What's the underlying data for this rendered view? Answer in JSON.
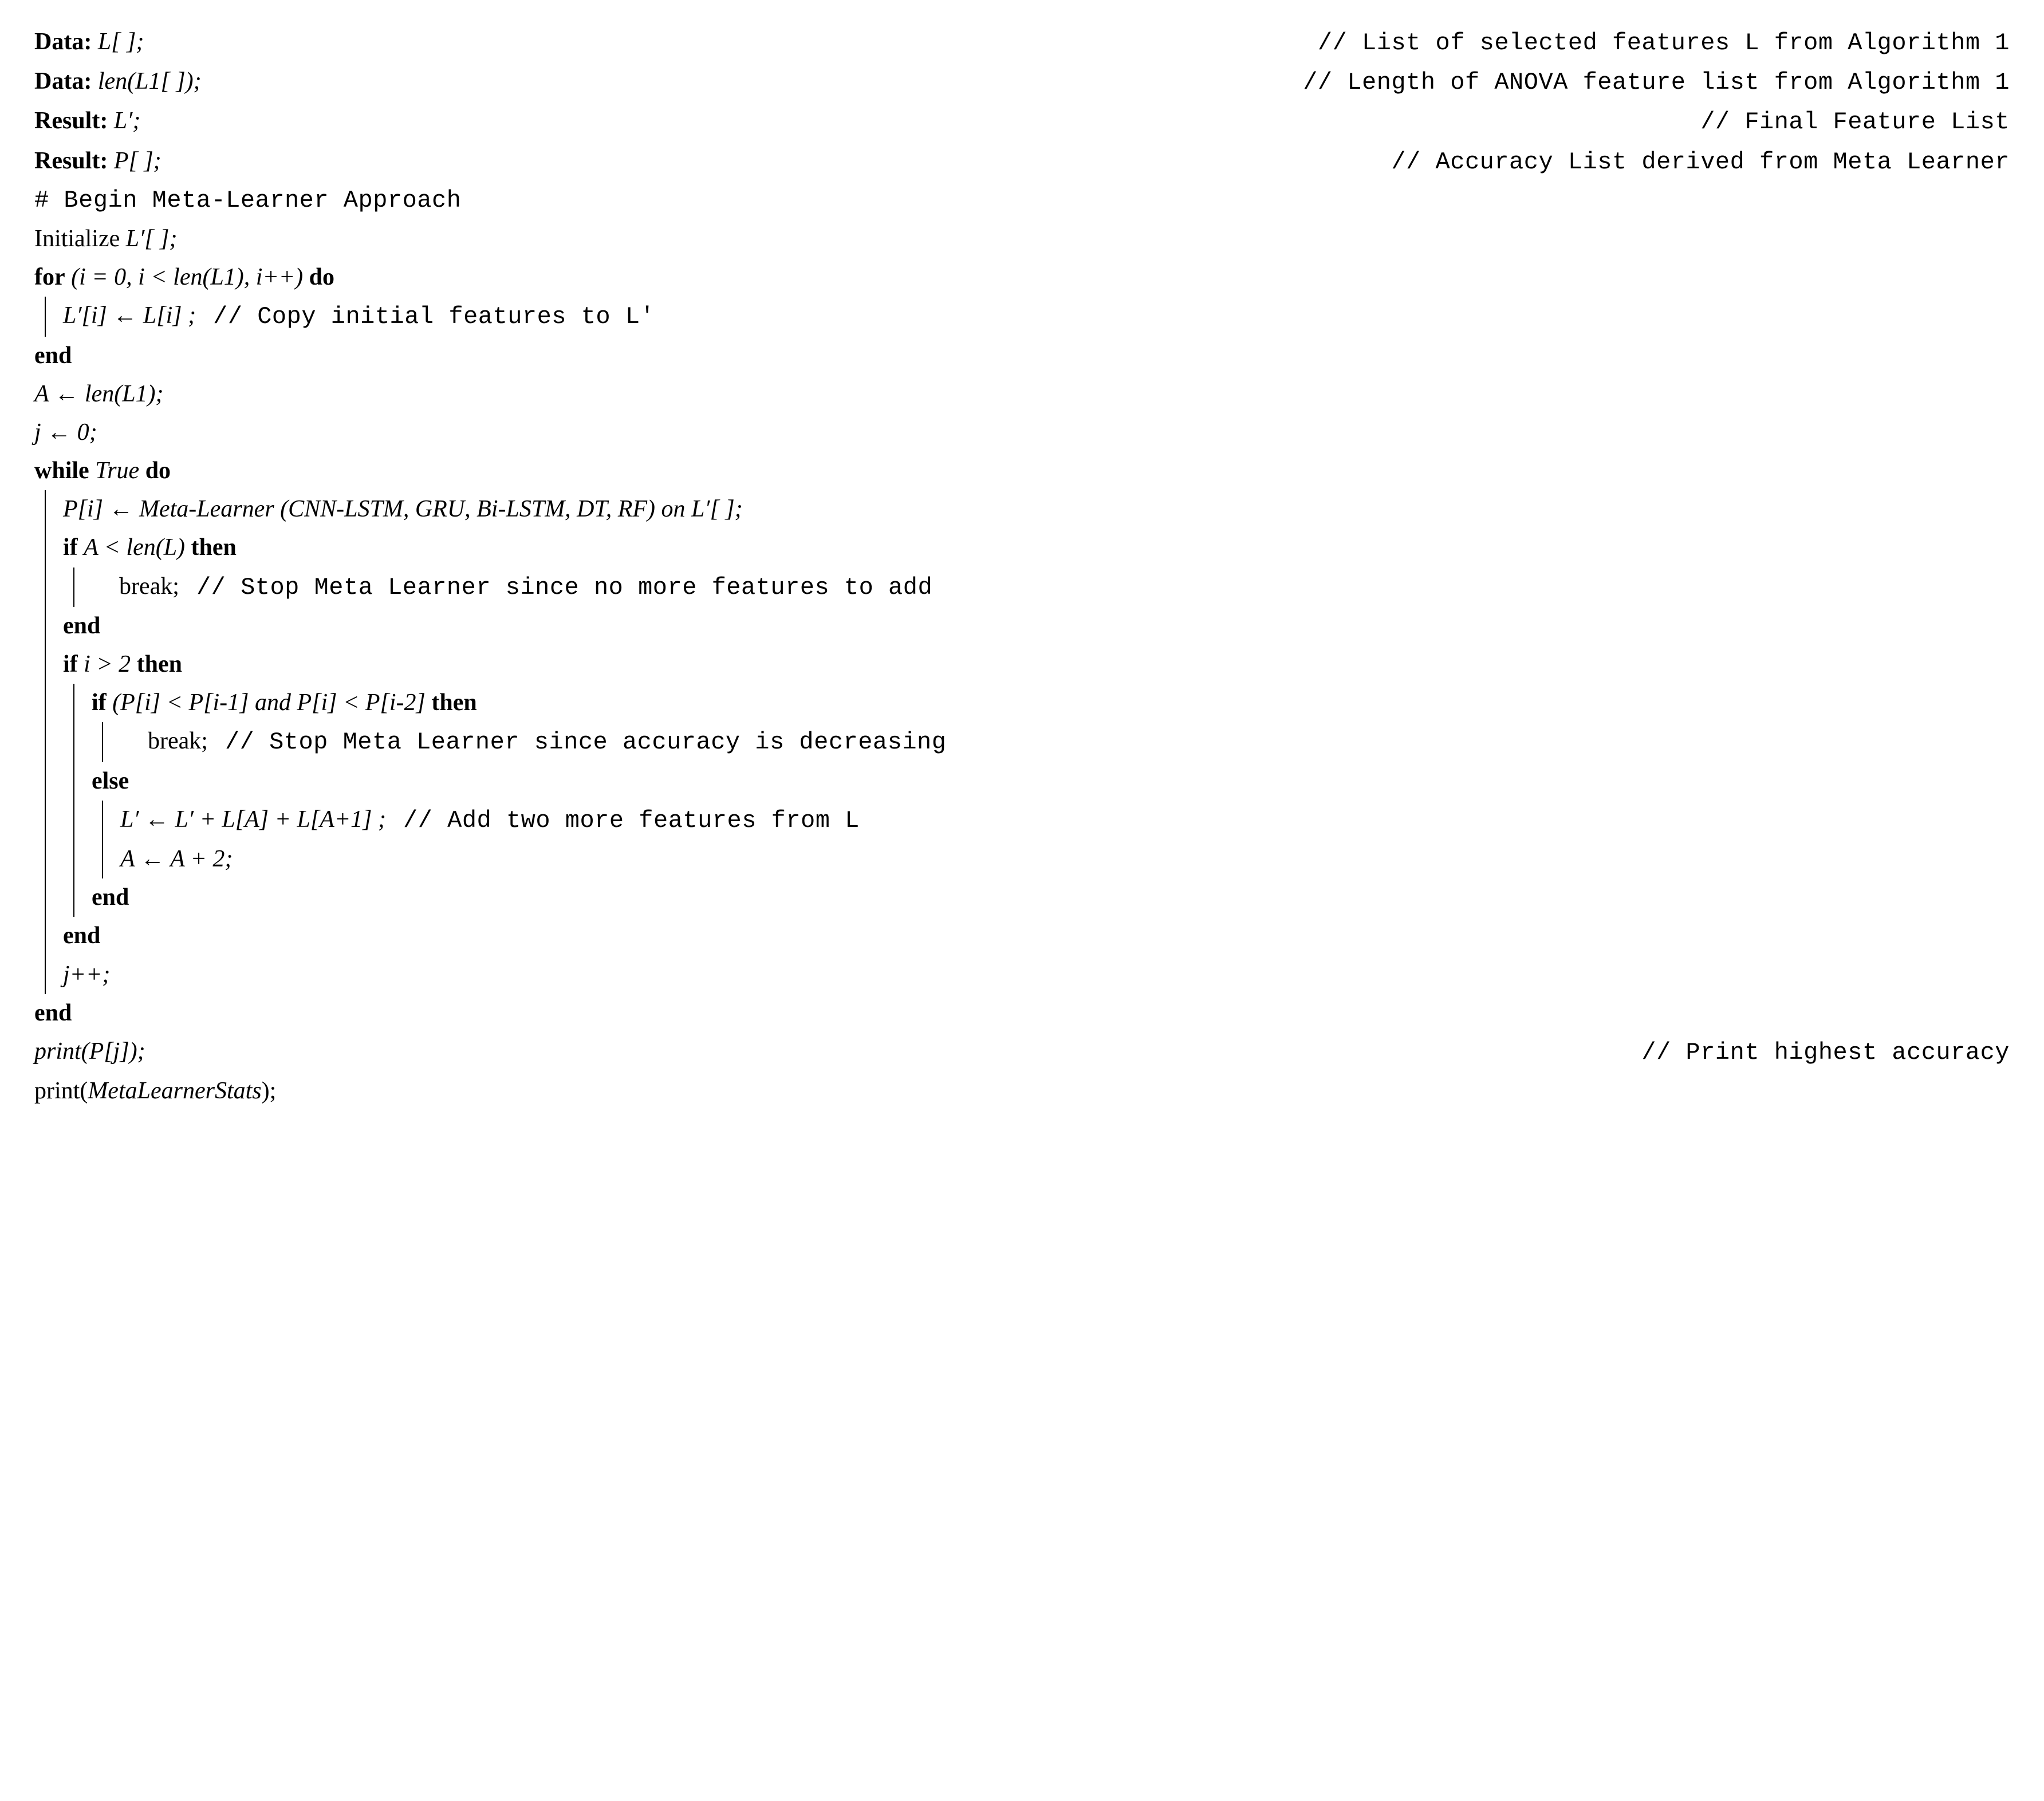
{
  "l1": {
    "label": "Data:",
    "expr": "L[ ];",
    "comment": "// List of selected features L from Algorithm 1"
  },
  "l2": {
    "label": "Data:",
    "expr": "len(L1[ ]);",
    "comment": "// Length of ANOVA feature list from Algorithm 1"
  },
  "l3": {
    "label": "Result:",
    "expr": "L′;",
    "comment": "// Final Feature List"
  },
  "l4": {
    "label": "Result:",
    "expr": "P[ ];",
    "comment": "// Accuracy List derived from Meta Learner"
  },
  "l5": "# Begin Meta-Learner Approach",
  "l6": {
    "pre": "Initialize ",
    "expr": "L′[ ];"
  },
  "l7": {
    "kw1": "for",
    "cond": "(i = 0, i < len(L1), i++)",
    "kw2": "do"
  },
  "l8": {
    "expr": "L′[i] ← L[i] ;",
    "comment": "// Copy initial features to L'"
  },
  "l9": "end",
  "l10": {
    "expr": "A ← len(L1);"
  },
  "l11": {
    "expr": "j ← 0;"
  },
  "l12": {
    "kw1": "while",
    "cond": "True",
    "kw2": "do"
  },
  "l13": {
    "expr": "P[i] ← Meta-Learner (CNN-LSTM, GRU, Bi-LSTM, DT, RF) on L′[ ];"
  },
  "l14": {
    "kw1": "if",
    "cond": "A < len(L)",
    "kw2": "then"
  },
  "l15": {
    "expr": "break;",
    "comment": "// Stop Meta Learner since no more features to add"
  },
  "l16": "end",
  "l17": {
    "kw1": "if",
    "cond": "i > 2",
    "kw2": "then"
  },
  "l18": {
    "kw1": "if",
    "cond": "(P[i] < P[i-1] and P[i] < P[i-2]",
    "kw2": "then"
  },
  "l19": {
    "expr": "break;",
    "comment": "// Stop Meta Learner since accuracy is decreasing"
  },
  "l20": "else",
  "l21": {
    "expr": "L′ ← L′ + L[A] + L[A+1] ;",
    "comment": "// Add two more features from L"
  },
  "l22": {
    "expr": "A ← A + 2;"
  },
  "l23": "end",
  "l24": "end",
  "l25": {
    "expr": "j++;"
  },
  "l26": "end",
  "l27": {
    "expr": "print(P[j]);",
    "comment": "// Print highest accuracy"
  },
  "l28": {
    "pre": "print(",
    "expr": "MetaLearnerStats",
    "post": ");"
  }
}
